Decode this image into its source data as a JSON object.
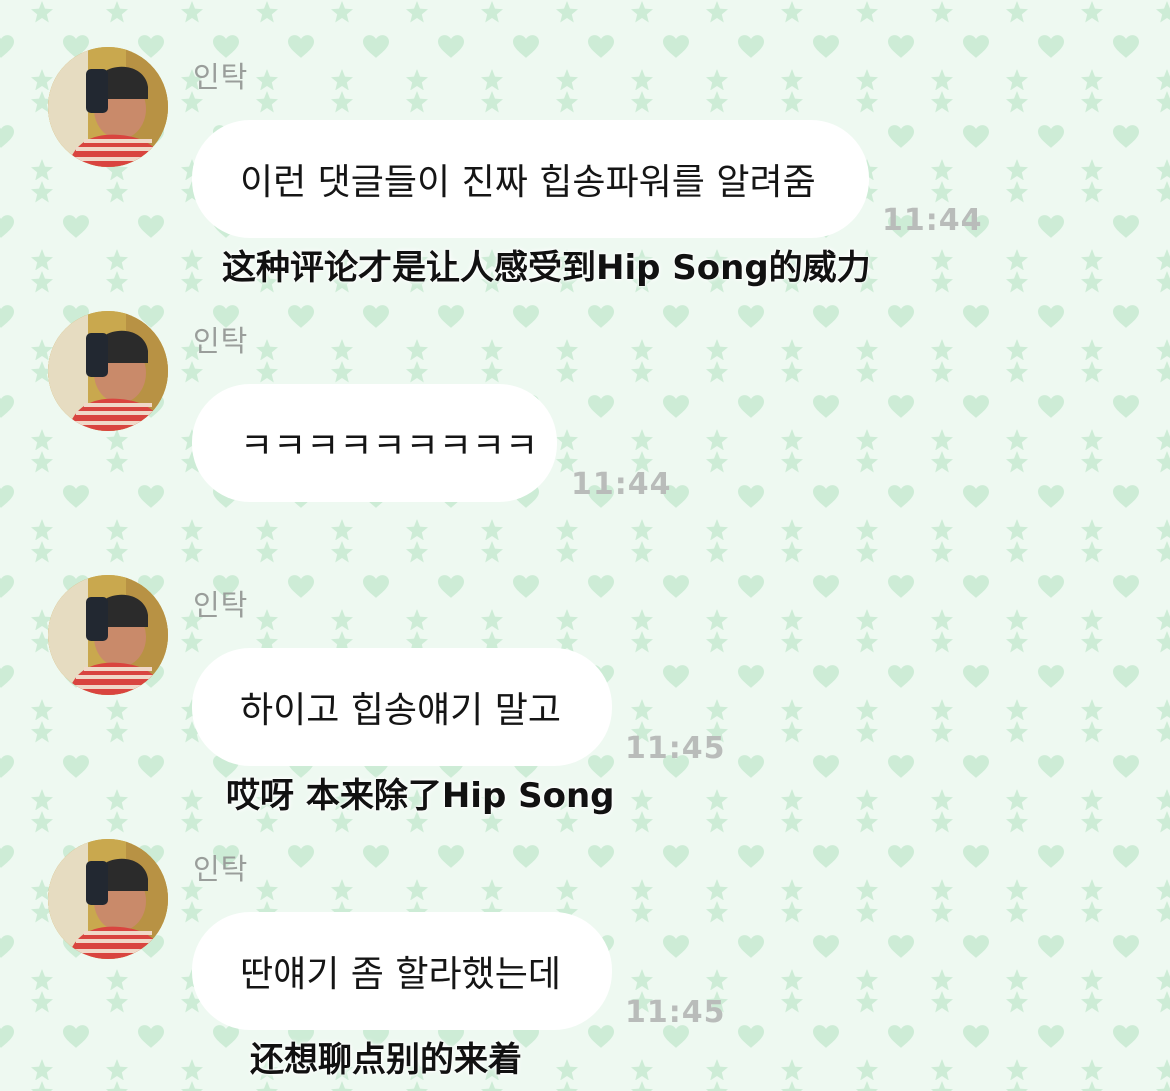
{
  "colors": {
    "background": "#eef9f1",
    "pattern": "#cdecd6",
    "bubble": "#ffffff",
    "timestamp": "#b9bcba",
    "sender": "#9a9e9b"
  },
  "messages": [
    {
      "sender": "인탁",
      "text": "이런 댓글들이 진짜 힙송파워를 알려줌",
      "time": "11:44",
      "translation": "这种评论才是让人感受到Hip Song的威力"
    },
    {
      "sender": "인탁",
      "text": "ㅋㅋㅋㅋㅋㅋㅋㅋㅋ",
      "time": "11:44",
      "translation": ""
    },
    {
      "sender": "인탁",
      "text": "하이고 힙송얘기 말고",
      "time": "11:45",
      "translation": "哎呀 本来除了Hip Song"
    },
    {
      "sender": "인탁",
      "text": "딴얘기 좀 할라했는데",
      "time": "11:45",
      "translation": "还想聊点别的来着"
    }
  ]
}
